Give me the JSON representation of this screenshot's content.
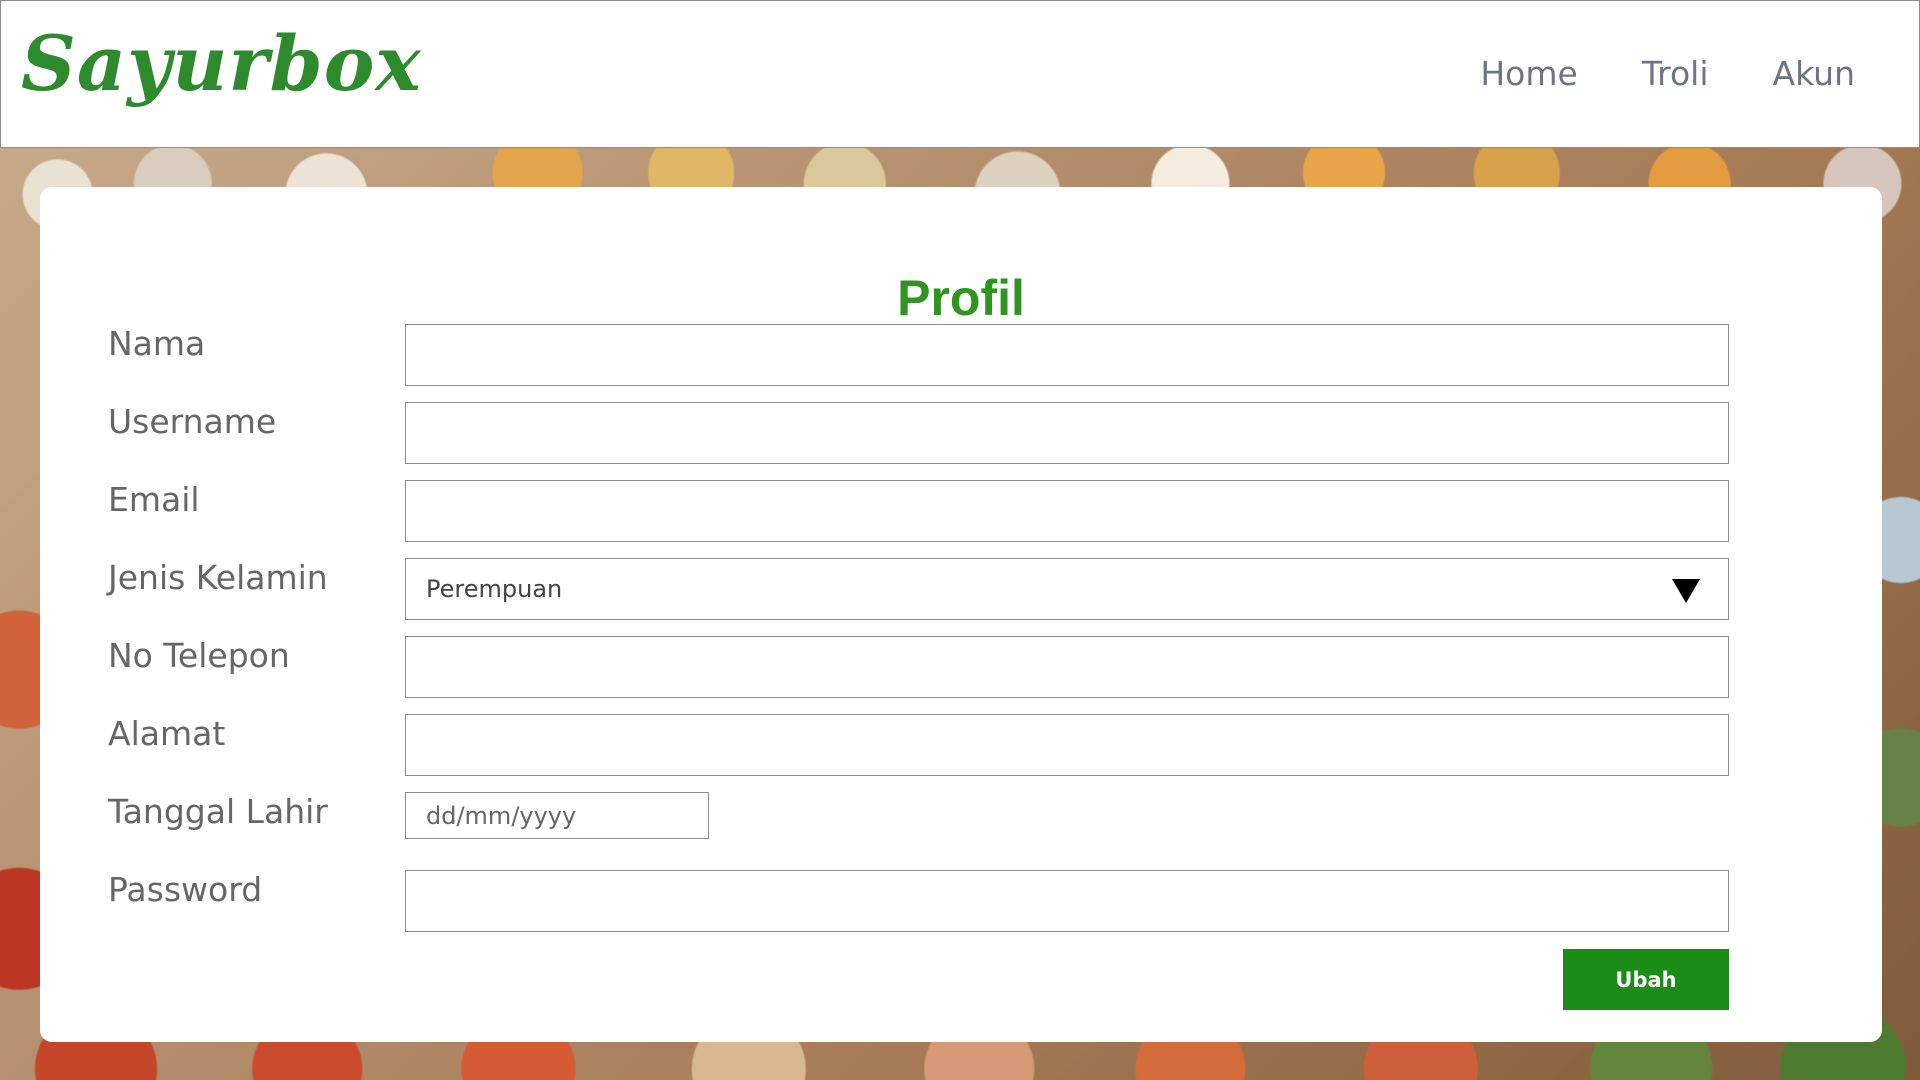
{
  "header": {
    "brand": "Sayurbox",
    "nav": [
      "Home",
      "Troli",
      "Akun"
    ]
  },
  "profile": {
    "title": "Profil",
    "fields": [
      {
        "label": "Nama",
        "value": ""
      },
      {
        "label": "Username",
        "value": ""
      },
      {
        "label": "Email",
        "value": ""
      },
      {
        "label": "Jenis Kelamin",
        "value": "Perempuan"
      },
      {
        "label": "No Telepon",
        "value": ""
      },
      {
        "label": "Alamat",
        "value": ""
      },
      {
        "label": "Tanggal Lahir",
        "value": "dd/mm/yyyy"
      },
      {
        "label": "Password",
        "value": ""
      }
    ],
    "button_label": "Ubah"
  },
  "icons": {
    "dropdown": "chevron-down-icon"
  },
  "colors": {
    "brand": "#2d8b2d",
    "title": "#2f9420",
    "button": "#1b8c16"
  }
}
